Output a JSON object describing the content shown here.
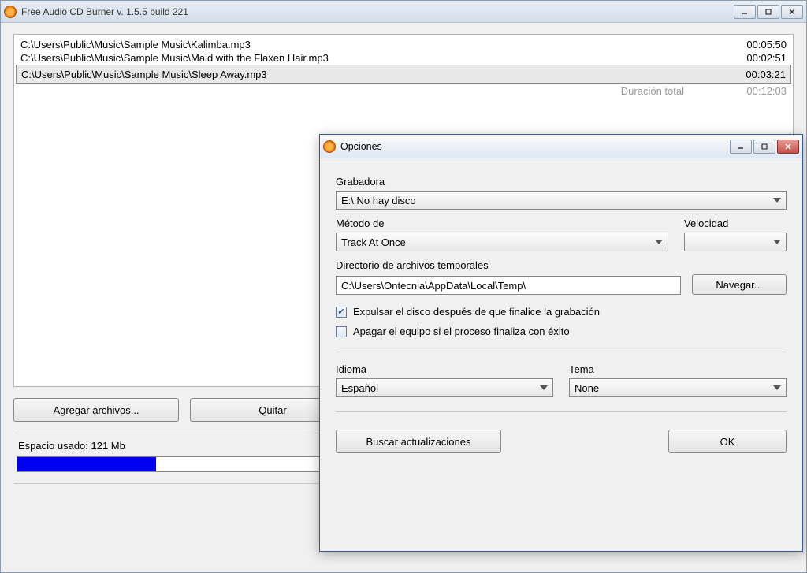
{
  "main": {
    "title": "Free Audio CD Burner  v. 1.5.5 build 221",
    "files": [
      {
        "path": "C:\\Users\\Public\\Music\\Sample Music\\Kalimba.mp3",
        "duration": "00:05:50",
        "selected": false
      },
      {
        "path": "C:\\Users\\Public\\Music\\Sample Music\\Maid with the Flaxen Hair.mp3",
        "duration": "00:02:51",
        "selected": false
      },
      {
        "path": "C:\\Users\\Public\\Music\\Sample Music\\Sleep Away.mp3",
        "duration": "00:03:21",
        "selected": true
      }
    ],
    "total_label": "Duración total",
    "total_duration": "00:12:03",
    "buttons": {
      "add": "Agregar archivos...",
      "remove": "Quitar"
    },
    "space_label": "Espacio usado:  121 Mb"
  },
  "dialog": {
    "title": "Opciones",
    "recorder_label": "Grabadora",
    "recorder_value": "E:\\ No hay disco",
    "method_label": "Método de",
    "method_value": "Track At Once",
    "speed_label": "Velocidad",
    "speed_value": "",
    "tempdir_label": "Directorio de archivos temporales",
    "tempdir_value": "C:\\Users\\Ontecnia\\AppData\\Local\\Temp\\",
    "browse_label": "Navegar...",
    "eject_checked": true,
    "eject_label": "Expulsar el disco después de que finalice la grabación",
    "shutdown_checked": false,
    "shutdown_label": "Apagar el equipo si el proceso finaliza con éxito",
    "language_label": "Idioma",
    "language_value": "Español",
    "theme_label": "Tema",
    "theme_value": "None",
    "update_label": "Buscar actualizaciones",
    "ok_label": "OK"
  }
}
